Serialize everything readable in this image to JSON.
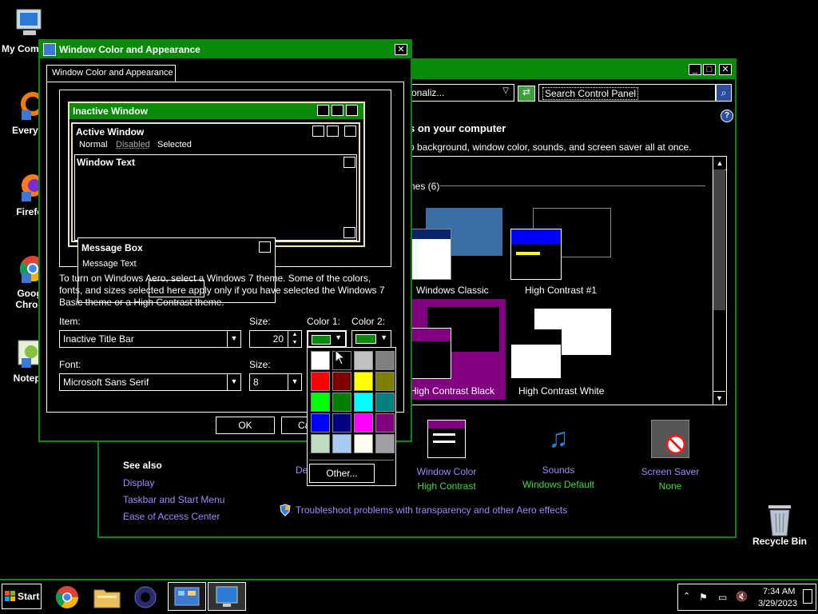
{
  "desktop": {
    "icons": [
      {
        "label": "My Com"
      },
      {
        "label": "Everyth"
      },
      {
        "label": "Firefo"
      },
      {
        "label": "Goog Chron"
      },
      {
        "label": "Notepa"
      }
    ],
    "recycle_bin": "Recycle Bin"
  },
  "cp": {
    "address": "onaliz...",
    "search_placeholder": "Search Control Panel",
    "heading": "s on your computer",
    "subheading": "p background, window color, sounds, and screen saver all at once.",
    "group_label": "nes (6)",
    "themes": [
      {
        "label": "Windows Classic"
      },
      {
        "label": "High Contrast #1"
      },
      {
        "label": "High Contrast Black"
      },
      {
        "label": "High Contrast White"
      }
    ],
    "bottom": {
      "desktop_label": "De",
      "window_color": {
        "label": "Window Color",
        "value": "High Contrast"
      },
      "sounds": {
        "label": "Sounds",
        "value": "Windows Default"
      },
      "screensaver": {
        "label": "Screen Saver",
        "value": "None"
      }
    },
    "see_also": {
      "title": "See also",
      "links": [
        "Display",
        "Taskbar and Start Menu",
        "Ease of Access Center"
      ]
    },
    "troubleshoot": "Troubleshoot problems with transparency and other Aero effects"
  },
  "dialog": {
    "title": "Window Color and Appearance",
    "tab": "Window Color and Appearance",
    "preview": {
      "inactive": "Inactive Window",
      "active": "Active Window",
      "menu": [
        "Normal",
        "Disabled",
        "Selected"
      ],
      "window_text": "Window Text",
      "msgbox_title": "Message Box",
      "msgbox_text": "Message Text"
    },
    "info": "To turn on Windows Aero, select a Windows 7 theme.  Some of the colors, fonts, and sizes selected here apply only if you have selected the Windows 7 Basic theme or a High Contrast theme.",
    "item_label": "Item:",
    "item_value": "Inactive Title Bar",
    "size_label": "Size:",
    "size_value": "20",
    "color1_label": "Color 1:",
    "color2_label": "Color 2:",
    "font_label": "Font:",
    "font_value": "Microsoft Sans Serif",
    "font_size_label": "Size:",
    "font_size_value": "8",
    "ok": "OK",
    "cancel": "Ca"
  },
  "palette": {
    "colors": [
      "#ffffff",
      "#000000",
      "#c0c0c0",
      "#808080",
      "#ff0000",
      "#800000",
      "#ffff00",
      "#808000",
      "#00ff00",
      "#008000",
      "#00ffff",
      "#008080",
      "#0000ff",
      "#000080",
      "#ff00ff",
      "#800080",
      "#c0dcc0",
      "#a6caf0",
      "#fffbf0",
      "#a0a0a4"
    ],
    "other": "Other..."
  },
  "taskbar": {
    "start": "Start",
    "time": "7:34 AM",
    "date": "3/29/2023"
  },
  "colors": {
    "accent": "#0a8a0a",
    "link": "#9b8cff",
    "selected_theme": "#800080"
  }
}
